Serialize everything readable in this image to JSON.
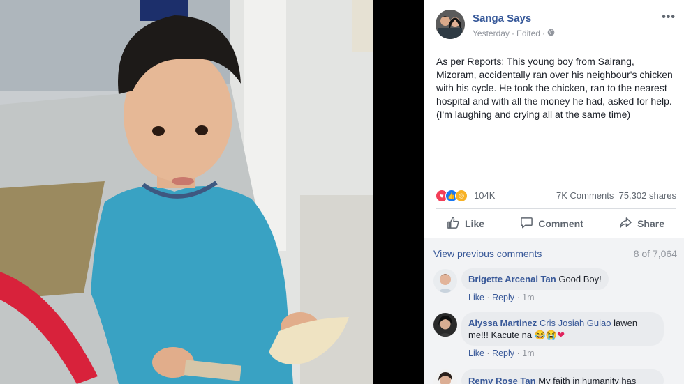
{
  "post": {
    "author": "Sanga Says",
    "time": "Yesterday",
    "edited": "Edited",
    "separator": "·",
    "more": "•••",
    "text": "As per Reports: This young boy from Sairang, Mizoram, accidentally ran over his neighbour's chicken with his cycle. He took the chicken, ran to the nearest hospital and with all the money he had, asked for help.\n(I'm laughing and crying all at the same time)"
  },
  "stats": {
    "reactions": "104K",
    "comments": "7K Comments",
    "shares": "75,302 shares"
  },
  "actions": {
    "like": "Like",
    "comment": "Comment",
    "share": "Share"
  },
  "comments_section": {
    "view_previous": "View previous comments",
    "count": "8 of 7,064",
    "items": [
      {
        "name": "Brigette Arcenal Tan",
        "text": "Good Boy!",
        "like": "Like",
        "reply": "Reply",
        "time": "1m"
      },
      {
        "name": "Alyssa Martinez",
        "tag": "Cris Josiah Guiao",
        "text_a": "lawen",
        "text_b": "me!!! Kacute na",
        "like": "Like",
        "reply": "Reply",
        "time": "1m"
      },
      {
        "name": "Remy Rose Tan",
        "text": "My faith in humanity has"
      }
    ]
  },
  "colors": {
    "link": "#385898",
    "author": "#365899",
    "secondary": "#90949c",
    "like_blue": "#1877f2",
    "love_red": "#f33e58",
    "sad_yellow": "#f7b125"
  },
  "icons": [
    "globe-icon",
    "like-icon",
    "comment-icon",
    "share-icon",
    "love-reaction-icon",
    "like-reaction-icon",
    "sad-reaction-icon"
  ]
}
